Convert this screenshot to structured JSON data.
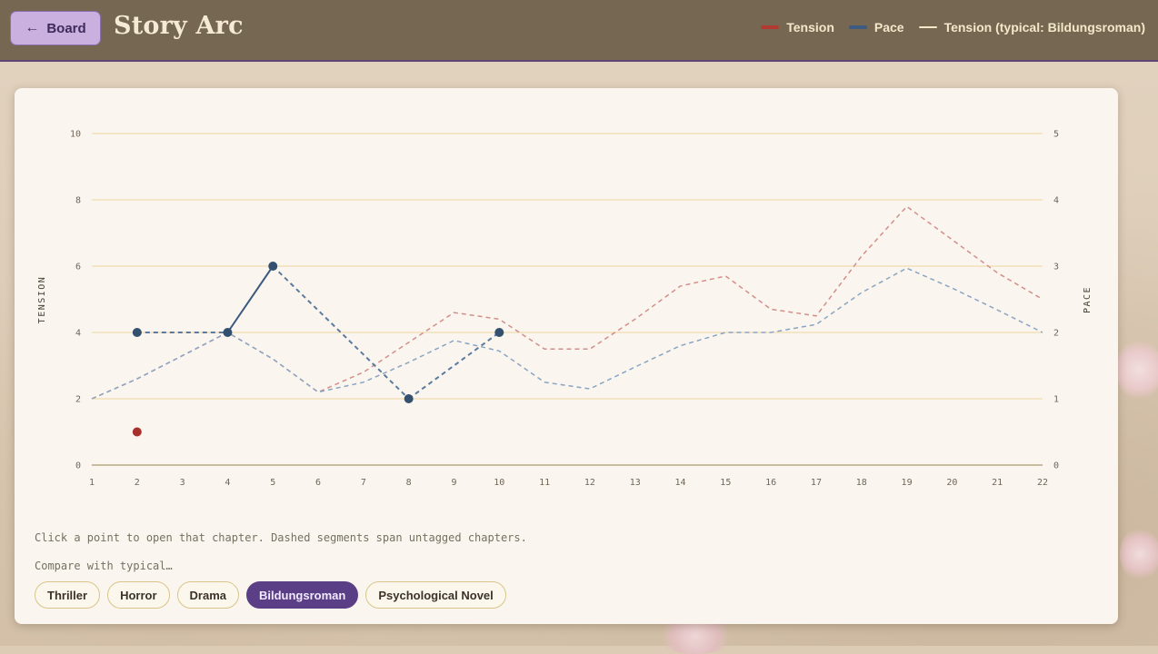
{
  "header": {
    "back_label": "Board",
    "title": "Story Arc",
    "legend": [
      {
        "label": "Tension",
        "color": "#b23a32",
        "style": "solid"
      },
      {
        "label": "Pace",
        "color": "#3d5a80",
        "style": "solid"
      },
      {
        "label": "Tension (typical: Bildungsroman)",
        "color": "#f3e8c8",
        "style": "solid"
      }
    ]
  },
  "chart_data": {
    "type": "line",
    "x": [
      1,
      2,
      3,
      4,
      5,
      6,
      7,
      8,
      9,
      10,
      11,
      12,
      13,
      14,
      15,
      16,
      17,
      18,
      19,
      20,
      21,
      22
    ],
    "ylabel_left": "TENSION",
    "ylabel_right": "PACE",
    "ylim_left": [
      0,
      10
    ],
    "ylim_right": [
      0,
      5
    ],
    "yticks_left": [
      0,
      2,
      4,
      6,
      8,
      10
    ],
    "yticks_right": [
      0,
      1,
      2,
      3,
      4,
      5
    ],
    "grid": true,
    "series": [
      {
        "name": "Tension",
        "axis": "left",
        "color": "#b23a32",
        "points": [
          [
            2,
            1
          ]
        ]
      },
      {
        "name": "Pace",
        "axis": "right",
        "color": "#3d5a80",
        "points": [
          [
            2,
            2
          ],
          [
            4,
            2
          ],
          [
            5,
            3
          ],
          [
            8,
            1
          ],
          [
            10,
            2
          ]
        ]
      },
      {
        "name": "Tension (typical: Bildungsroman)",
        "axis": "left",
        "style": "dashed",
        "color": "#d48e8a",
        "points": [
          [
            1,
            2
          ],
          [
            2,
            2.6
          ],
          [
            3,
            3.3
          ],
          [
            4,
            4
          ],
          [
            5,
            3.2
          ],
          [
            6,
            2.2
          ],
          [
            7,
            2.8
          ],
          [
            8,
            3.7
          ],
          [
            9,
            4.6
          ],
          [
            10,
            4.4
          ],
          [
            11,
            3.5
          ],
          [
            12,
            3.5
          ],
          [
            13,
            4.4
          ],
          [
            14,
            5.4
          ],
          [
            15,
            5.7
          ],
          [
            16,
            4.7
          ],
          [
            17,
            4.5
          ],
          [
            18,
            6.3
          ],
          [
            19,
            7.8
          ],
          [
            20,
            6.8
          ],
          [
            21,
            5.8
          ],
          [
            22,
            5
          ]
        ]
      },
      {
        "name": "Pace (typical)",
        "axis": "right",
        "style": "dashed",
        "color": "#8aa4c2",
        "points": [
          [
            1,
            1
          ],
          [
            2,
            1.3
          ],
          [
            3,
            1.65
          ],
          [
            4,
            2
          ],
          [
            5,
            1.6
          ],
          [
            6,
            1.1
          ],
          [
            7,
            1.25
          ],
          [
            8,
            1.55
          ],
          [
            9,
            1.88
          ],
          [
            10,
            1.72
          ],
          [
            11,
            1.25
          ],
          [
            12,
            1.15
          ],
          [
            13,
            1.48
          ],
          [
            14,
            1.8
          ],
          [
            15,
            2
          ],
          [
            16,
            2
          ],
          [
            17,
            2.12
          ],
          [
            18,
            2.6
          ],
          [
            19,
            2.97
          ],
          [
            20,
            2.67
          ],
          [
            21,
            2.34
          ],
          [
            22,
            2
          ]
        ]
      }
    ]
  },
  "hint_text": "Click a point to open that chapter. Dashed segments span untagged chapters.",
  "compare_label": "Compare with typical…",
  "genres": [
    {
      "label": "Thriller",
      "active": false
    },
    {
      "label": "Horror",
      "active": false
    },
    {
      "label": "Drama",
      "active": false
    },
    {
      "label": "Bildungsroman",
      "active": true
    },
    {
      "label": "Psychological Novel",
      "active": false
    }
  ]
}
